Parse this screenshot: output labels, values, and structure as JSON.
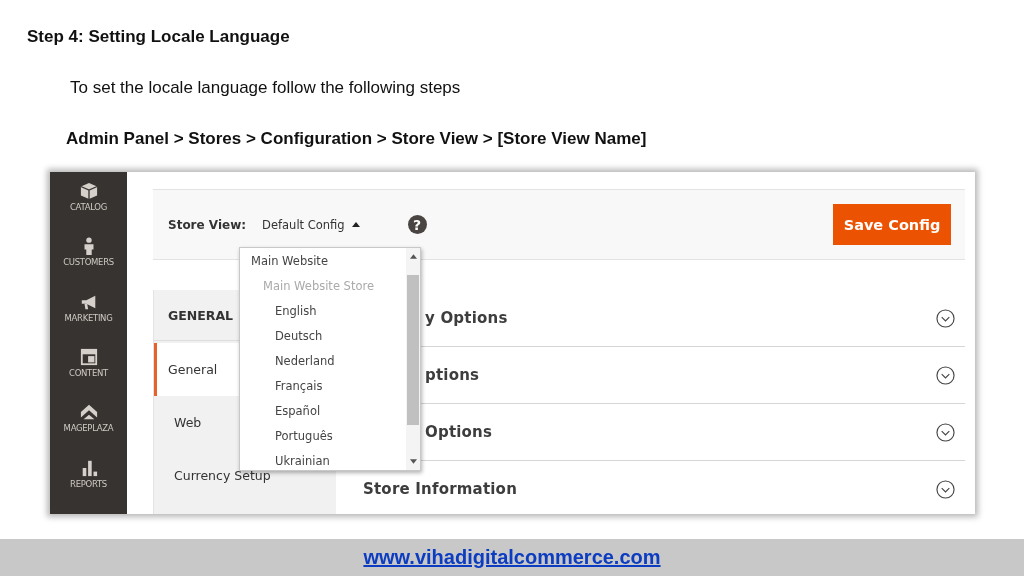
{
  "heading": "Step 4: Setting Locale Language",
  "intro": "To set the locale language follow the following steps",
  "path": "Admin Panel > Stores > Configuration > Store View > [Store View Name]",
  "screenshot": {
    "sidebar": {
      "items": [
        {
          "label": "CATALOG",
          "kind": "box"
        },
        {
          "label": "CUSTOMERS",
          "kind": "person"
        },
        {
          "label": "MARKETING",
          "kind": "megaphone"
        },
        {
          "label": "CONTENT",
          "kind": "layout"
        },
        {
          "label": "MAGEPLAZA",
          "kind": "chevrons"
        },
        {
          "label": "REPORTS",
          "kind": "bars"
        }
      ]
    },
    "store_view": {
      "label": "Store View:",
      "value": "Default Config",
      "expanded": true,
      "help": "?"
    },
    "save_button": "Save Config",
    "scope_menu": {
      "items": [
        {
          "label": "Main Website",
          "kind": "website",
          "disabled": false
        },
        {
          "label": "Main Website Store",
          "kind": "store",
          "disabled": true
        },
        {
          "label": "English",
          "kind": "view",
          "disabled": false
        },
        {
          "label": "Deutsch",
          "kind": "view",
          "disabled": false
        },
        {
          "label": "Nederland",
          "kind": "view",
          "disabled": false
        },
        {
          "label": "Français",
          "kind": "view",
          "disabled": false
        },
        {
          "label": "Español",
          "kind": "view",
          "disabled": false
        },
        {
          "label": "Português",
          "kind": "view",
          "disabled": false
        },
        {
          "label": "Ukrainian",
          "kind": "view",
          "disabled": false
        }
      ]
    },
    "config_nav": {
      "title": "GENERAL",
      "items": [
        {
          "label": "General",
          "selected": true
        },
        {
          "label": "Web",
          "selected": false
        },
        {
          "label": "Currency Setup",
          "selected": false
        }
      ]
    },
    "sections": [
      {
        "title": "y Options",
        "expanded": false
      },
      {
        "title": "ptions",
        "expanded": false
      },
      {
        "title": "Options",
        "expanded": false
      },
      {
        "title": "Store Information",
        "expanded": false
      }
    ]
  },
  "footer_link": "www.vihadigitalcommerce.com"
}
